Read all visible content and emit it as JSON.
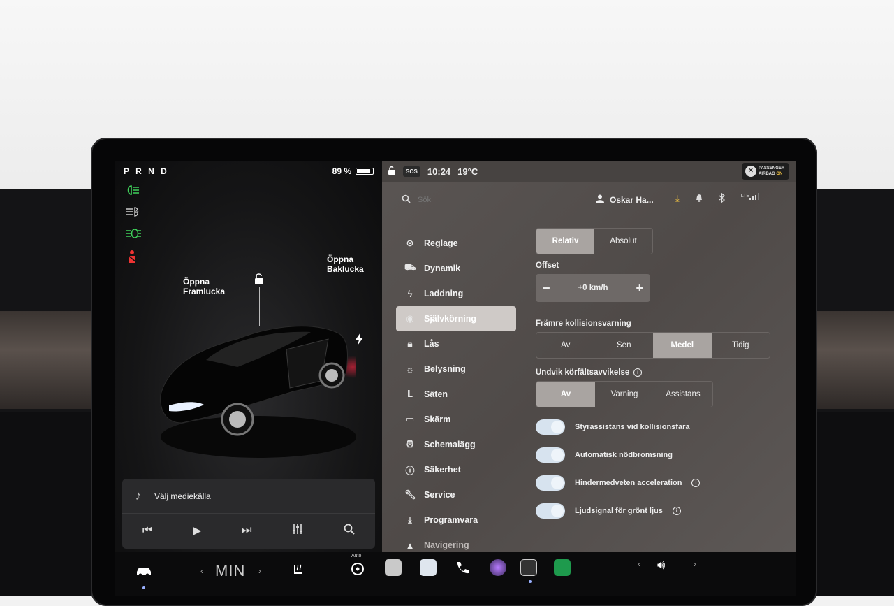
{
  "left_panel": {
    "gear": "P R N D",
    "battery": "89 %",
    "battery_level": 0.89,
    "front_trunk": {
      "line1": "Öppna",
      "line2": "Framlucka"
    },
    "rear_trunk": {
      "line1": "Öppna",
      "line2": "Baklucka"
    },
    "status_icons": [
      "headlight-icon",
      "auto-headlight-icon",
      "fog-light-icon",
      "seatbelt-warning-icon"
    ],
    "media": {
      "label": "Välj mediekälla"
    }
  },
  "topbar": {
    "sos": "SOS",
    "time": "10:24",
    "temperature": "19°C",
    "airbag_line1": "PASSENGER",
    "airbag_line2": "AIRBAG",
    "airbag_state": "ON"
  },
  "search": {
    "placeholder": "Sök"
  },
  "user": {
    "name": "Oskar Ha..."
  },
  "lte": "LTE",
  "nav": {
    "items": [
      {
        "label": "Reglage",
        "icon": "toggle-icon"
      },
      {
        "label": "Dynamik",
        "icon": "car-icon"
      },
      {
        "label": "Laddning",
        "icon": "bolt-icon"
      },
      {
        "label": "Självkörning",
        "icon": "steering-wheel-icon"
      },
      {
        "label": "Lås",
        "icon": "lock-icon"
      },
      {
        "label": "Belysning",
        "icon": "sun-icon"
      },
      {
        "label": "Säten",
        "icon": "seat-icon"
      },
      {
        "label": "Skärm",
        "icon": "display-icon"
      },
      {
        "label": "Schemalägg",
        "icon": "alarm-icon"
      },
      {
        "label": "Säkerhet",
        "icon": "info-icon"
      },
      {
        "label": "Service",
        "icon": "wrench-icon"
      },
      {
        "label": "Programvara",
        "icon": "download-icon"
      },
      {
        "label": "Navigering",
        "icon": "navigation-icon"
      }
    ]
  },
  "settings": {
    "speed_mode": {
      "options": [
        "Relativ",
        "Absolut"
      ],
      "selected": "Relativ"
    },
    "offset": {
      "label": "Offset",
      "value": "+0 km/h"
    },
    "collision_warning": {
      "label": "Främre kollisionsvarning",
      "options": [
        "Av",
        "Sen",
        "Medel",
        "Tidig"
      ],
      "selected": "Medel"
    },
    "lane_departure": {
      "label": "Undvik körfältsavvikelse",
      "options": [
        "Av",
        "Varning",
        "Assistans"
      ],
      "selected": "Av"
    },
    "toggles": [
      {
        "label": "Styrassistans vid kollisionsfara",
        "on": true,
        "info": false
      },
      {
        "label": "Automatisk nödbromsning",
        "on": true,
        "info": false
      },
      {
        "label": "Hindermedveten acceleration",
        "on": true,
        "info": true
      },
      {
        "label": "Ljudsignal för grönt ljus",
        "on": true,
        "info": true
      }
    ]
  },
  "taskbar": {
    "temp": "MIN",
    "auto": "Auto"
  }
}
